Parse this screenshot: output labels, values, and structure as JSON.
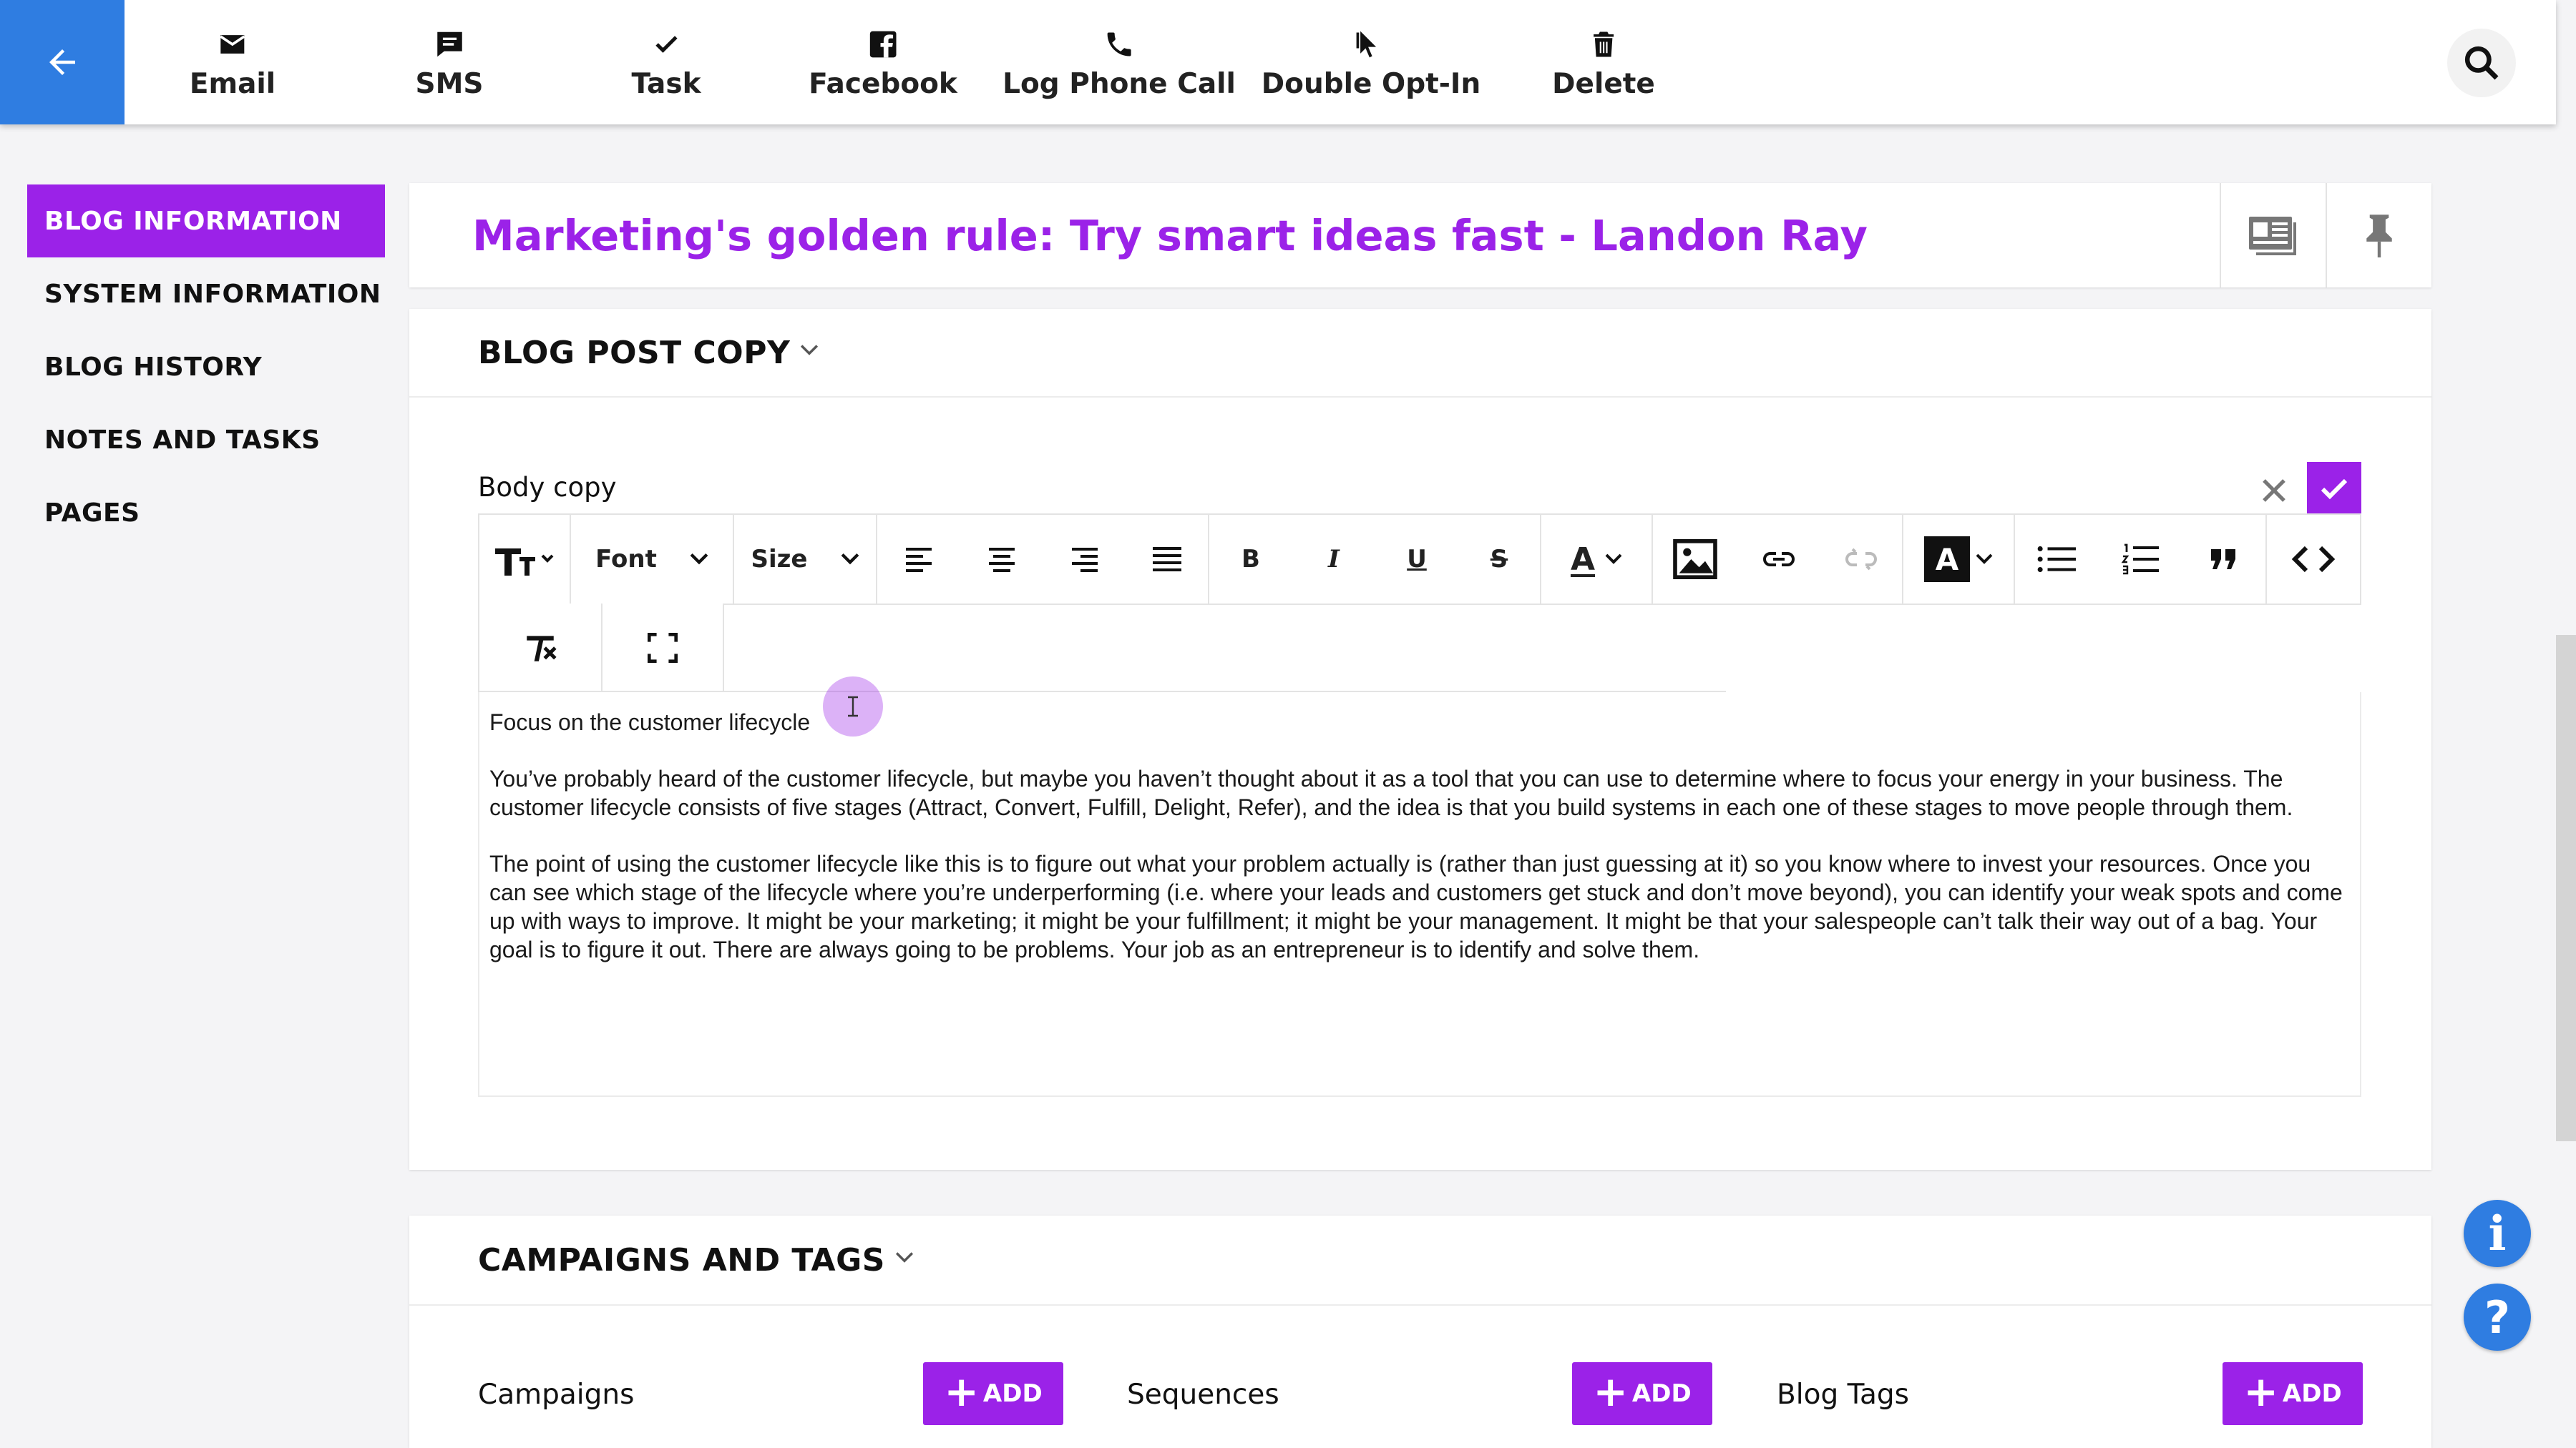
{
  "colors": {
    "accent": "#9b22e8",
    "primary_blue": "#2f7de1",
    "background": "#f4f4f6"
  },
  "toolbar": {
    "items": [
      {
        "label": "Email",
        "icon": "envelope-icon"
      },
      {
        "label": "SMS",
        "icon": "chat-bubble-icon"
      },
      {
        "label": "Task",
        "icon": "checkmark-icon"
      },
      {
        "label": "Facebook",
        "icon": "facebook-icon"
      },
      {
        "label": "Log Phone Call",
        "icon": "phone-icon"
      },
      {
        "label": "Double Opt-In",
        "icon": "double-cursor-icon"
      },
      {
        "label": "Delete",
        "icon": "trash-icon"
      }
    ]
  },
  "sidebar": {
    "items": [
      {
        "label": "BLOG INFORMATION",
        "active": true
      },
      {
        "label": "SYSTEM INFORMATION"
      },
      {
        "label": "BLOG HISTORY"
      },
      {
        "label": "NOTES AND TASKS"
      },
      {
        "label": "PAGES"
      }
    ]
  },
  "record": {
    "title": "Marketing's golden rule: Try smart ideas fast - Landon Ray"
  },
  "blog_post_copy": {
    "heading": "BLOG POST COPY",
    "field_label": "Body copy",
    "editor_toolbar": {
      "font_label": "Font",
      "size_label": "Size",
      "bold_label": "B",
      "italic_label": "I",
      "underline_label": "U",
      "strike_label": "S",
      "textcolor_label": "A",
      "bgcolor_label": "A"
    },
    "paragraphs": [
      "Focus on the customer lifecycle",
      "You’ve probably heard of the customer lifecycle, but maybe you haven’t thought about it as a tool that you can use to determine where to focus your energy in your business. The customer lifecycle consists of five stages (Attract, Convert, Fulfill, Delight, Refer), and the idea is that you build systems in each one of these stages to move people through them.",
      "The point of using the customer lifecycle like this is to figure out what your problem actually is (rather than just guessing at it) so you know where to invest your resources. Once you can see which stage of the lifecycle where you’re underperforming (i.e. where your leads and customers get stuck and don’t move beyond), you can identify your weak spots and come up with ways to improve. It might be your marketing; it might be your fulfillment; it might be your management. It might be that your salespeople can’t talk their way out of a bag. Your goal is to figure it out. There are always going to be problems. Your job as an entrepreneur is to identify and solve them."
    ]
  },
  "campaigns_and_tags": {
    "heading": "CAMPAIGNS AND TAGS",
    "add_label": "ADD",
    "fields": [
      {
        "label": "Campaigns"
      },
      {
        "label": "Sequences"
      },
      {
        "label": "Blog Tags"
      }
    ]
  },
  "floating": {
    "info_label": "i",
    "help_label": "?"
  }
}
